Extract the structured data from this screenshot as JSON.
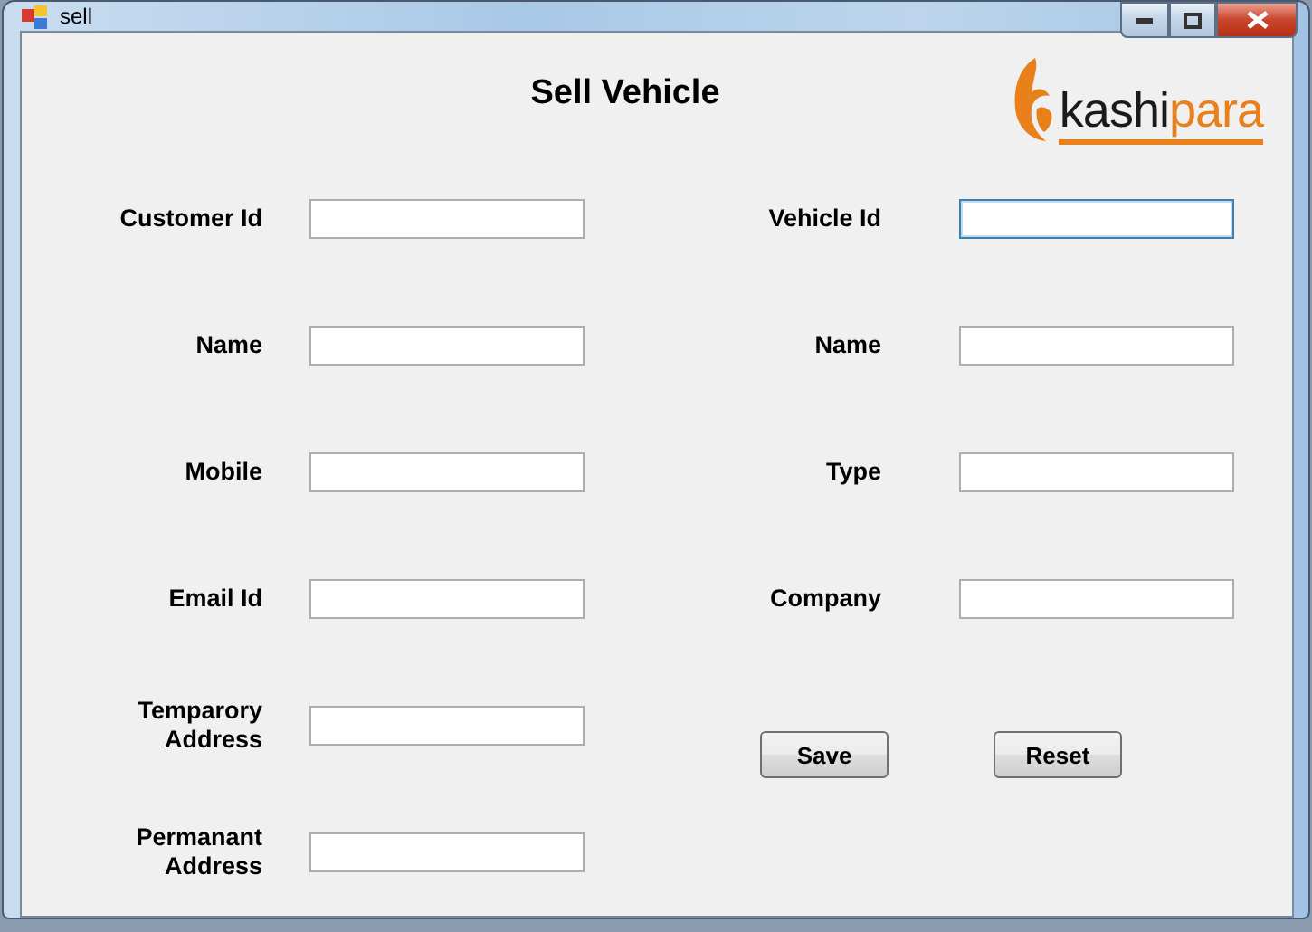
{
  "window": {
    "title": "sell"
  },
  "heading": "Sell Vehicle",
  "logo": {
    "first": "kashi",
    "second": "para"
  },
  "customer_fields": [
    {
      "label": "Customer Id",
      "focused": false
    },
    {
      "label": "Name",
      "focused": false
    },
    {
      "label": "Mobile",
      "focused": false
    },
    {
      "label": "Email Id",
      "focused": false
    },
    {
      "label": "Temparory\nAddress",
      "focused": false
    },
    {
      "label": "Permanant\n Address",
      "focused": false
    }
  ],
  "vehicle_fields": [
    {
      "label": "Vehicle Id",
      "focused": true
    },
    {
      "label": "Name",
      "focused": false
    },
    {
      "label": "Type",
      "focused": false
    },
    {
      "label": "Company",
      "focused": false
    }
  ],
  "buttons": [
    "Save",
    "Reset"
  ]
}
